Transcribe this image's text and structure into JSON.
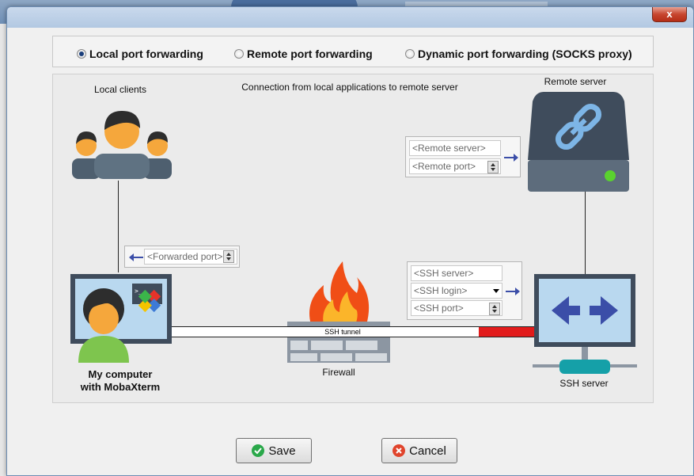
{
  "window": {
    "close_label": "x"
  },
  "modes": [
    {
      "label": "Local port forwarding",
      "selected": true
    },
    {
      "label": "Remote port forwarding",
      "selected": false
    },
    {
      "label": "Dynamic port forwarding (SOCKS proxy)",
      "selected": false
    }
  ],
  "diagram": {
    "title": "Connection from local applications to remote server",
    "local_clients": "Local clients",
    "remote_server": "Remote server",
    "my_computer_line1": "My computer",
    "my_computer_line2": "with MobaXterm",
    "firewall": "Firewall",
    "ssh_server": "SSH server",
    "tunnel_label": "SSH tunnel"
  },
  "fields": {
    "remote_server_placeholder": "<Remote server>",
    "remote_port_placeholder": "<Remote port>",
    "forwarded_port_placeholder": "<Forwarded port>",
    "ssh_server_placeholder": "<SSH server>",
    "ssh_login_placeholder": "<SSH login>",
    "ssh_port_placeholder": "<SSH port>"
  },
  "buttons": {
    "save": "Save",
    "cancel": "Cancel"
  },
  "icons": [
    "users-icon",
    "server-link-icon",
    "computer-mobaxterm-icon",
    "firewall-icon",
    "ssh-server-icon",
    "arrow-right-icon",
    "arrow-left-icon",
    "save-check-icon",
    "cancel-x-icon"
  ],
  "colors": {
    "accent_blue": "#3b4ea8",
    "tunnel_red": "#e21b1b",
    "server_dark": "#3f4c5c",
    "monitor_blue": "#b9d8ef",
    "person_orange": "#f5a73c",
    "save_green": "#2aa84a",
    "cancel_red": "#e0442c"
  }
}
